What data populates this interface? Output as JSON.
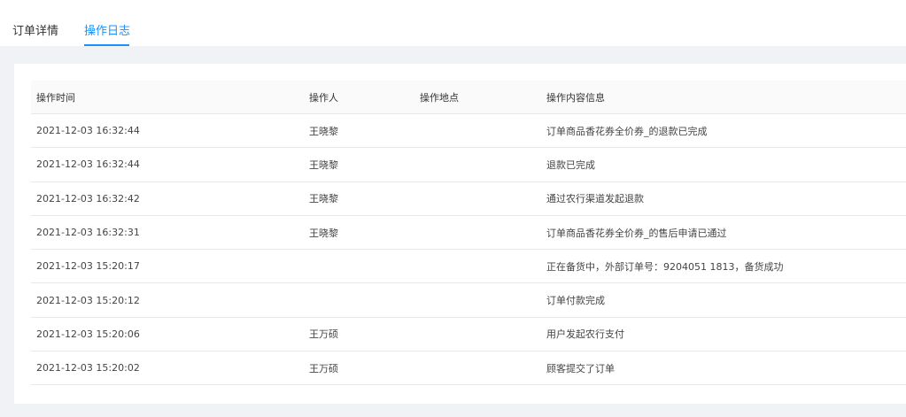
{
  "tabs": [
    {
      "label": "订单详情",
      "active": false
    },
    {
      "label": "操作日志",
      "active": true
    }
  ],
  "colors": {
    "accent": "#1890ff",
    "page_bg": "#f0f2f5",
    "header_bg": "#fafafa"
  },
  "table": {
    "headers": {
      "time": "操作时间",
      "operator": "操作人",
      "location": "操作地点",
      "info": "操作内容信息"
    },
    "rows": [
      {
        "time": "2021-12-03 16:32:44",
        "operator": "王晓黎",
        "location": "",
        "info": "订单商品香花券全价券_的退款已完成"
      },
      {
        "time": "2021-12-03 16:32:44",
        "operator": "王晓黎",
        "location": "",
        "info": "退款已完成"
      },
      {
        "time": "2021-12-03 16:32:42",
        "operator": "王晓黎",
        "location": "",
        "info": "通过农行渠道发起退款"
      },
      {
        "time": "2021-12-03 16:32:31",
        "operator": "王晓黎",
        "location": "",
        "info": "订单商品香花券全价券_的售后申请已通过"
      },
      {
        "time": "2021-12-03 15:20:17",
        "operator": "",
        "location": "",
        "info": "正在备货中，外部订单号：9204051 1813，备货成功"
      },
      {
        "time": "2021-12-03 15:20:12",
        "operator": "",
        "location": "",
        "info": "订单付款完成"
      },
      {
        "time": "2021-12-03 15:20:06",
        "operator": "王万硕",
        "location": "",
        "info": "用户发起农行支付"
      },
      {
        "time": "2021-12-03 15:20:02",
        "operator": "王万硕",
        "location": "",
        "info": "顾客提交了订单"
      }
    ]
  }
}
